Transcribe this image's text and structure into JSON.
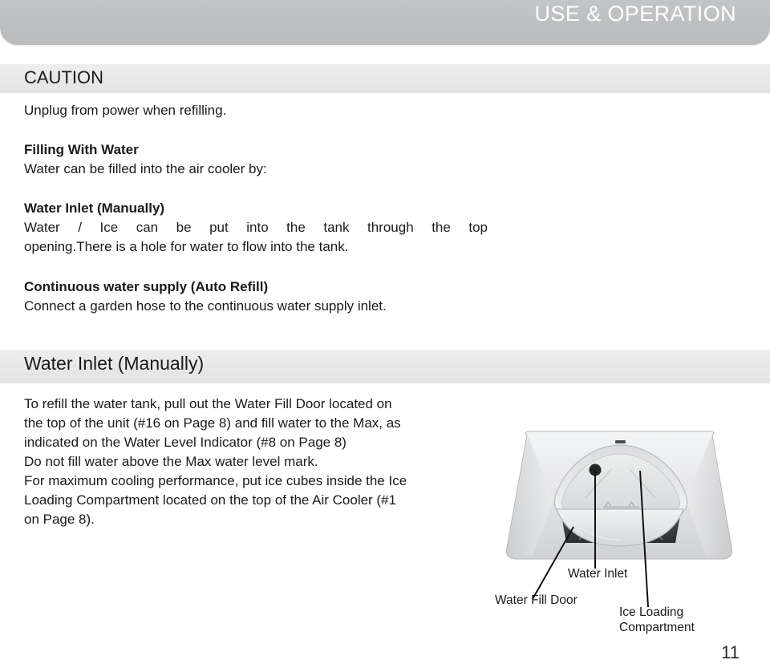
{
  "header": {
    "title": "USE & OPERATION"
  },
  "sections": {
    "caution": {
      "heading": "CAUTION",
      "body": "Unplug from power when refilling."
    },
    "filling_with_water": {
      "heading": "Filling With Water",
      "body": "Water can be filled into the air cooler by:"
    },
    "water_inlet_manual_short": {
      "heading": "Water Inlet (Manually)",
      "line1": "Water / Ice can be put into the tank through the top",
      "line2": "opening.There is a hole for water to flow into the tank."
    },
    "continuous_supply": {
      "heading": "Continuous water supply (Auto Refill)",
      "body": "Connect a garden hose to the continuous water supply inlet."
    },
    "water_inlet_manual": {
      "heading": "Water Inlet (Manually)",
      "line1": "To refill the water tank, pull out the Water Fill Door located on",
      "line2": "the top of the unit (#16 on Page 8) and fill water to the Max, as",
      "line3": "indicated on the Water Level Indicator (#8 on Page 8)",
      "line4": "Do not fill water above the Max water level mark.",
      "line5": "For maximum cooling performance, put ice cubes inside the Ice",
      "line6": "Loading Compartment located on the top of the Air Cooler (#1",
      "line7": "on Page 8)."
    }
  },
  "figure": {
    "callouts": {
      "water_inlet": "Water Inlet",
      "water_fill_door": "Water Fill Door",
      "ice_loading_line1": "Ice Loading",
      "ice_loading_line2": "Compartment"
    }
  },
  "footer": {
    "page_number": "11"
  },
  "colors": {
    "header_band": "#bdbfc1",
    "section_band": "#e7e7e7",
    "header_text": "#ffffff",
    "body_text": "#1a1a1a",
    "page_background": "#ffffff"
  }
}
